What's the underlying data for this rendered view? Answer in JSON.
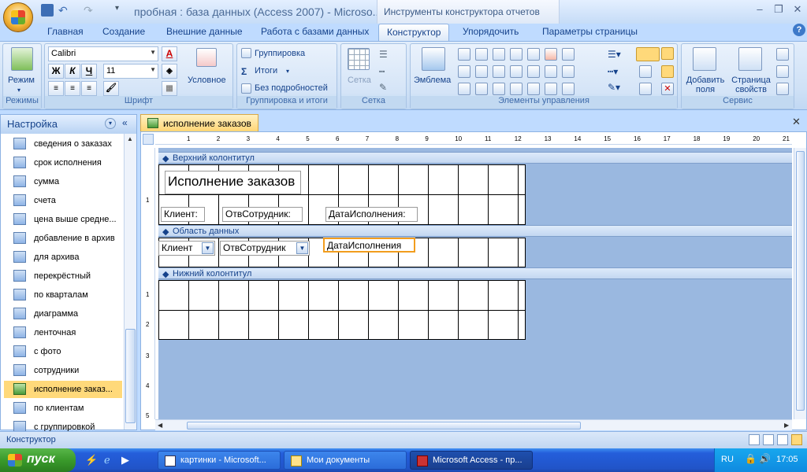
{
  "window": {
    "title": "пробная : база данных (Access 2007) - Microso...",
    "context_title": "Инструменты конструктора отчетов"
  },
  "tabs": [
    "Главная",
    "Создание",
    "Внешние данные",
    "Работа с базами данных",
    "Конструктор",
    "Упорядочить",
    "Параметры страницы"
  ],
  "ribbon": {
    "groups": {
      "views": "Режимы",
      "font": "Шрифт",
      "grouping": "Группировка и итоги",
      "grid": "Сетка",
      "controls": "Элементы управления",
      "tools": "Сервис"
    },
    "views_button": "Режим",
    "font_name": "Calibri",
    "font_size": "11",
    "conditional": "Условное",
    "grouping_btn": "Группировка",
    "totals_btn": "Итоги",
    "hide_details_btn": "Без подробностей",
    "grid_btn": "Сетка",
    "logo_btn": "Эмблема",
    "add_fields_btn": "Добавить поля",
    "property_sheet_btn": "Страница свойств"
  },
  "nav": {
    "header": "Настройка",
    "items": [
      "сведения о заказах",
      "срок исполнения",
      "сумма",
      "счета",
      "цена выше средне...",
      "добавление в архив",
      "для архива",
      "перекрёстный",
      "по кварталам",
      "диаграмма",
      "ленточная",
      "с фото",
      "сотрудники",
      "исполнение заказ...",
      "по клиентам",
      "с группировкой"
    ],
    "selected": "исполнение заказ..."
  },
  "document": {
    "tab": "исполнение заказов",
    "sections": {
      "header": "Верхний колонтитул",
      "detail": "Область данных",
      "footer": "Нижний колонтитул"
    },
    "title_label": "Исполнение заказов",
    "labels": [
      "Клиент:",
      "ОтвСотрудник:",
      "ДатаИсполнения:"
    ],
    "fields": [
      "Клиент",
      "ОтвСотрудник",
      "ДатаИсполнения"
    ],
    "ruler_marks": [
      "1",
      "2",
      "3",
      "4",
      "5",
      "6",
      "7",
      "8",
      "9",
      "10",
      "11",
      "12",
      "13",
      "14",
      "15",
      "16",
      "17",
      "18",
      "19",
      "20",
      "21"
    ]
  },
  "status": {
    "text": "Конструктор"
  },
  "taskbar": {
    "start": "пуск",
    "buttons": [
      "картинки - Microsoft...",
      "Мои документы",
      "Microsoft Access - пр..."
    ],
    "lang": "RU",
    "time": "17:05"
  }
}
